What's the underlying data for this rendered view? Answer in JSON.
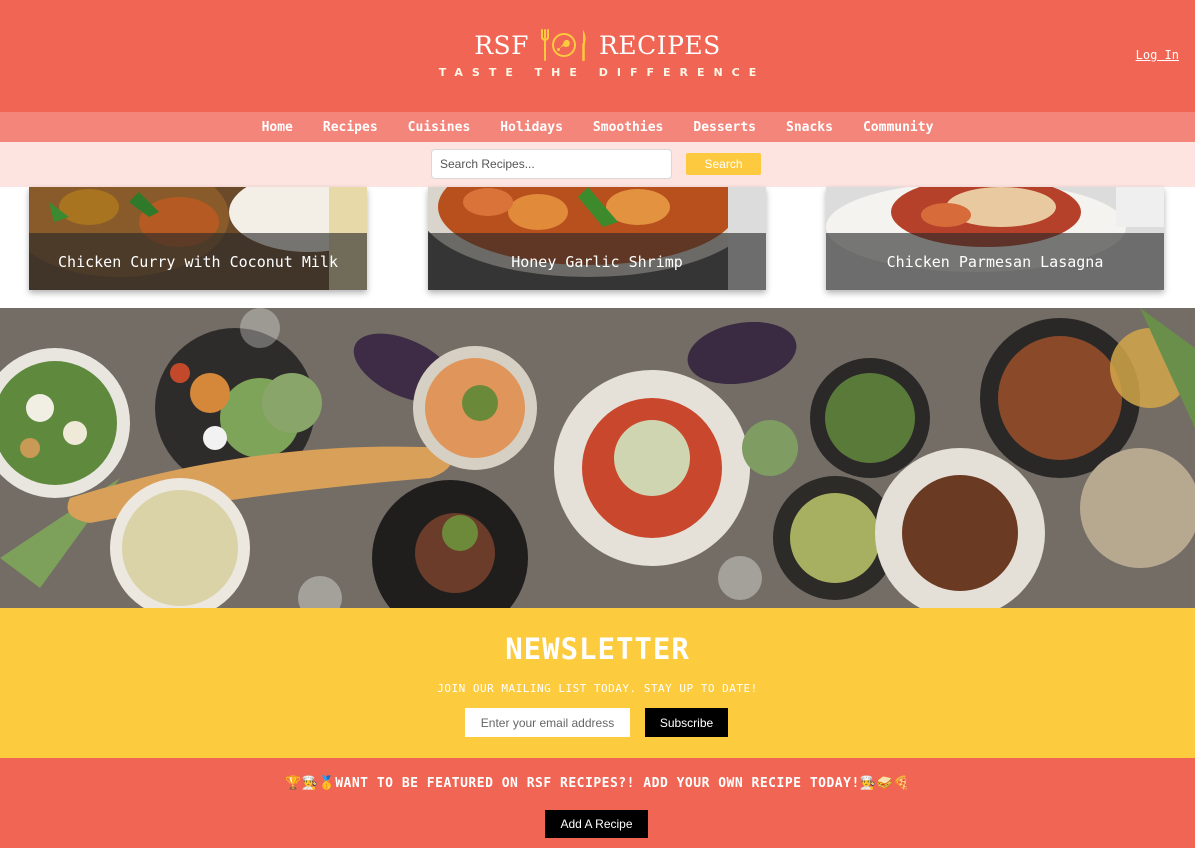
{
  "brand": {
    "name_left": "RSF",
    "name_right": "RECIPES",
    "tagline": "TASTE THE DIFFERENCE",
    "emblem_icon": "fork-chicken-knife-icon",
    "login_label": "Log In"
  },
  "nav": {
    "items": [
      {
        "label": "Home"
      },
      {
        "label": "Recipes"
      },
      {
        "label": "Cuisines"
      },
      {
        "label": "Holidays"
      },
      {
        "label": "Smoothies"
      },
      {
        "label": "Desserts"
      },
      {
        "label": "Snacks"
      },
      {
        "label": "Community"
      }
    ]
  },
  "search": {
    "placeholder": "Search Recipes...",
    "button_label": "Search"
  },
  "cards": [
    {
      "title": "Chicken Curry with Coconut Milk"
    },
    {
      "title": "Honey Garlic Shrimp"
    },
    {
      "title": "Chicken Parmesan Lasagna"
    }
  ],
  "newsletter": {
    "title": "NEWSLETTER",
    "subtitle": "JOIN OUR MAILING LIST TODAY. STAY UP TO DATE!",
    "email_placeholder": "Enter your email address",
    "button_label": "Subscribe"
  },
  "feature": {
    "text": "🏆👨‍🍳🥇WANT TO BE FEATURED ON RSF RECIPES?! ADD YOUR OWN RECIPE TODAY!👨‍🍳🥪🍕",
    "button_label": "Add A Recipe"
  },
  "colors": {
    "header": "#f06553",
    "nav": "#f4857a",
    "search_bar": "#fde4e0",
    "accent_yellow": "#fdc93f",
    "button_dark": "#000000"
  }
}
